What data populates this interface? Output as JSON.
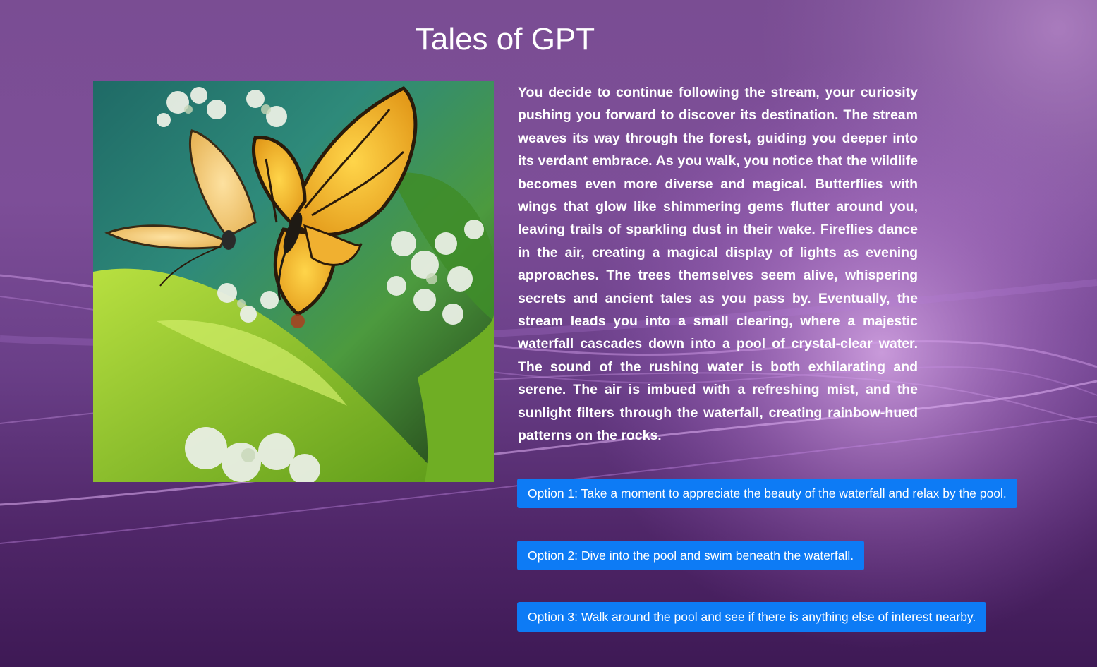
{
  "page": {
    "title": "Tales of GPT"
  },
  "story": {
    "image_icon": "butterfly-image",
    "text": "You decide to continue following the stream, your curiosity pushing you forward to discover its destination. The stream weaves its way through the forest, guiding you deeper into its verdant embrace. As you walk, you notice that the wildlife becomes even more diverse and magical. Butterflies with wings that glow like shimmering gems flutter around you, leaving trails of sparkling dust in their wake. Fireflies dance in the air, creating a magical display of lights as evening approaches. The trees themselves seem alive, whispering secrets and ancient tales as you pass by. Eventually, the stream leads you into a small clearing, where a majestic waterfall cascades down into a pool of crystal-clear water. The sound of the rushing water is both exhilarating and serene. The air is imbued with a refreshing mist, and the sunlight filters through the waterfall, creating rainbow-hued patterns on the rocks."
  },
  "options": [
    {
      "label": "Option 1: Take a moment to appreciate the beauty of the waterfall and relax by the pool."
    },
    {
      "label": "Option 2: Dive into the pool and swim beneath the waterfall."
    },
    {
      "label": "Option 3: Walk around the pool and see if there is anything else of interest nearby."
    }
  ],
  "colors": {
    "button": "#0d7bf5",
    "background": "#7a4d93",
    "text": "#ffffff"
  }
}
